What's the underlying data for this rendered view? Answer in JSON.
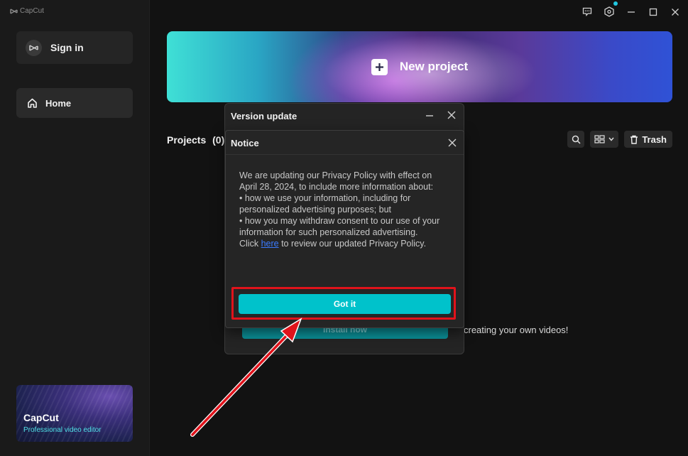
{
  "app": {
    "brand": "CapCut"
  },
  "sidebar": {
    "signin_label": "Sign in",
    "home_label": "Home",
    "promo": {
      "title": "CapCut",
      "subtitle": "Professional video editor"
    }
  },
  "titlebar": {
    "icons": [
      "feedback-icon",
      "settings-hex-icon",
      "minimize-icon",
      "maximize-icon",
      "close-icon"
    ]
  },
  "banner": {
    "label": "New project"
  },
  "projects": {
    "label": "Projects",
    "count": "(0)",
    "trash_label": "Trash"
  },
  "background_hint": "creating your own videos!",
  "version_dialog": {
    "title": "Version update",
    "install_label": "Install now"
  },
  "notice_dialog": {
    "title": "Notice",
    "para1": "We are updating our Privacy Policy with effect on April 28, 2024, to include more information about:",
    "bullet1": "• how we use your information, including for personalized advertising purposes; but",
    "bullet2": "• how you may withdraw consent to our use of your information for such personalized advertising.",
    "click_prefix": "Click ",
    "link_text": "here",
    "click_suffix": " to review our updated Privacy Policy.",
    "button_label": "Got it"
  },
  "colors": {
    "accent": "#00c2cb",
    "highlight": "#e0131b",
    "link": "#3b7bff",
    "background": "#121212"
  }
}
